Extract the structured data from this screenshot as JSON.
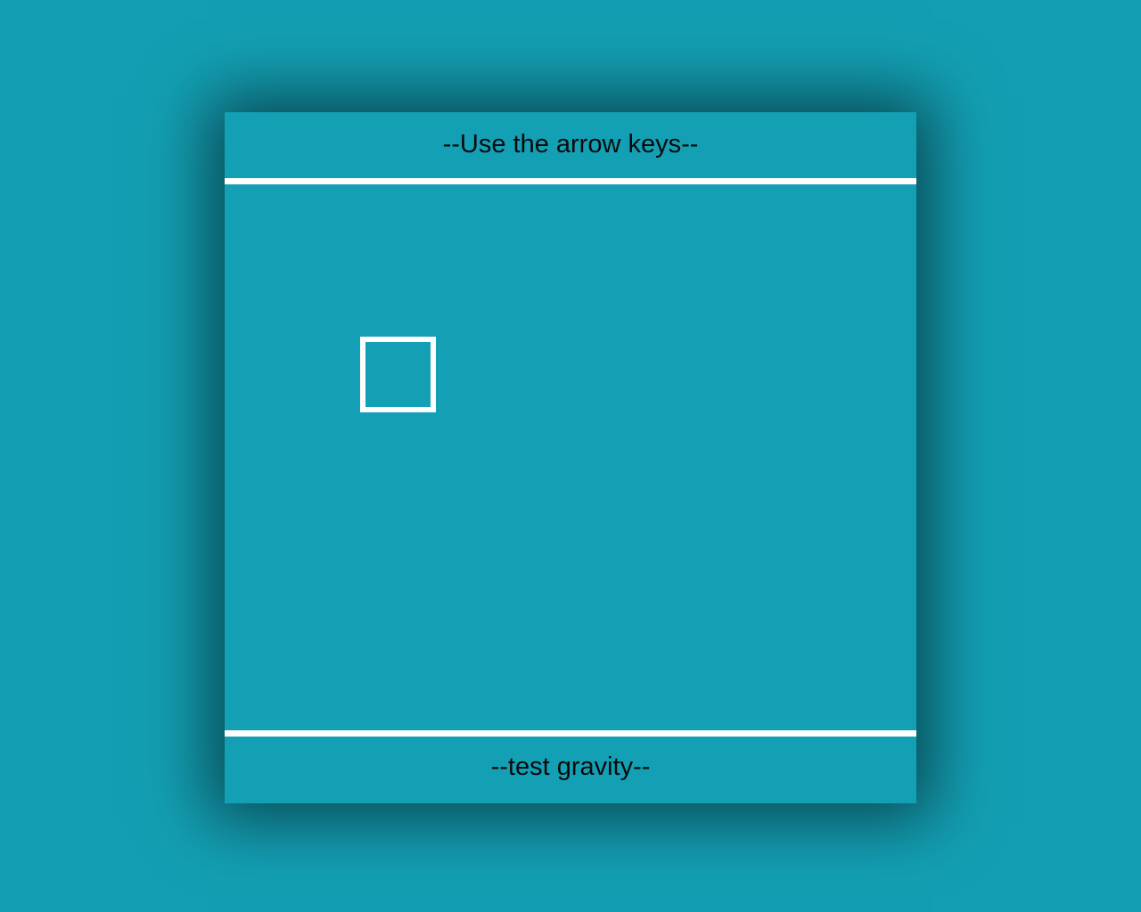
{
  "colors": {
    "background": "#139fb3",
    "stage": "#13a0b4",
    "rule": "#ffffff",
    "player_border": "#ffffff",
    "text": "#0a0a0a"
  },
  "header": {
    "instruction": "--Use the arrow keys--"
  },
  "footer": {
    "caption": "--test gravity--"
  },
  "game": {
    "player": {
      "shape": "hollow-square",
      "icon": "square-outline-icon"
    }
  }
}
